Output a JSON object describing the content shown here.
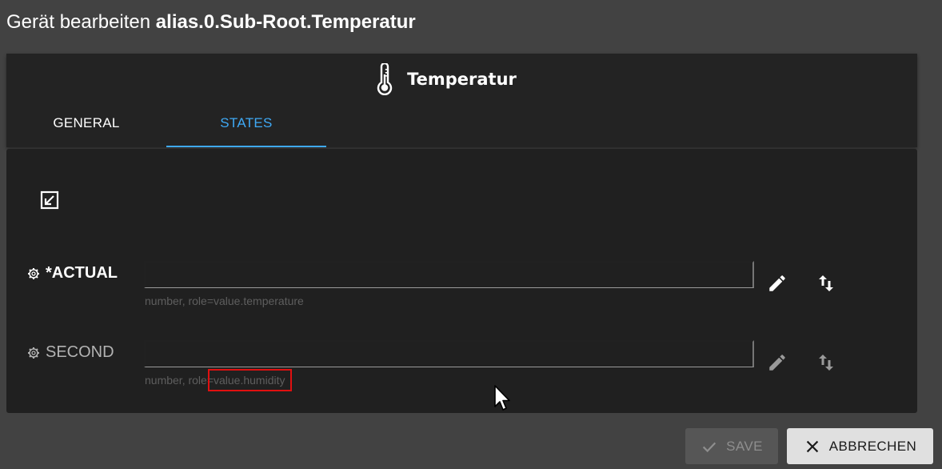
{
  "dialog": {
    "title_prefix": "Gerät bearbeiten ",
    "title_id": "alias.0.Sub-Root.Temperatur"
  },
  "device": {
    "name": "Temperatur",
    "icon": "thermometer-icon"
  },
  "tabs": [
    {
      "label": "GENERAL",
      "active": false
    },
    {
      "label": "STATES",
      "active": true
    }
  ],
  "states": [
    {
      "name": "*ACTUAL",
      "value": "",
      "hint_type": "number, role=",
      "hint_role": "value.temperature",
      "required": true
    },
    {
      "name": "SECOND",
      "value": "",
      "hint_type": "number, role=",
      "hint_role": "value.humidity",
      "required": false
    }
  ],
  "buttons": {
    "save_label": "SAVE",
    "cancel_label": "ABBRECHEN"
  },
  "colors": {
    "background": "#424242",
    "panel": "#202020",
    "accent": "#3fa9f5",
    "highlight_box": "#e01010"
  }
}
